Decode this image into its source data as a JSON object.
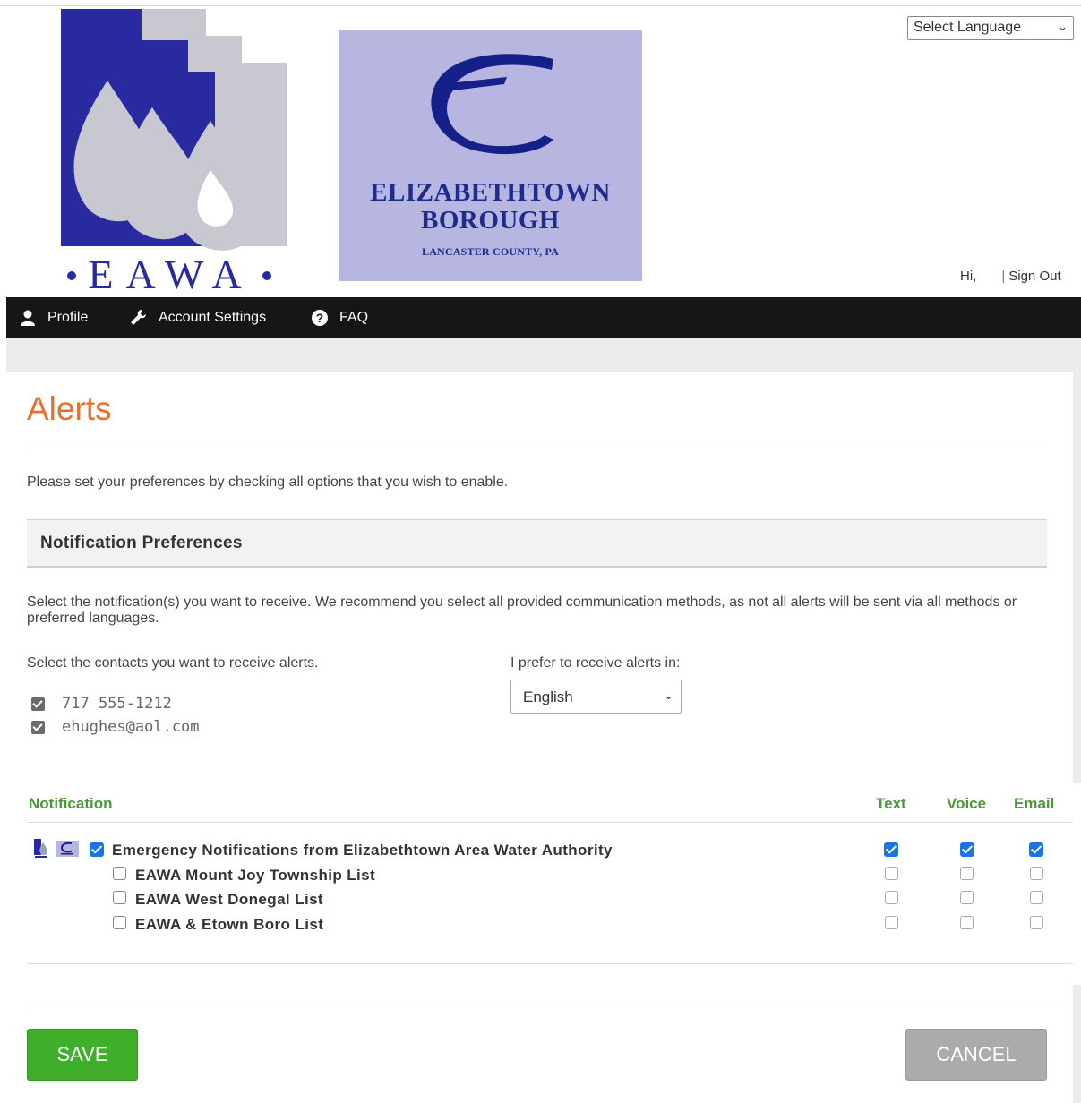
{
  "header": {
    "eawa_logo_text": "EAWA",
    "borough_name_line1": "ELIZABETHTOWN",
    "borough_name_line2": "BOROUGH",
    "borough_county": "LANCASTER COUNTY, PA",
    "language_select": "Select Language",
    "greeting": "Hi,",
    "sign_out": "Sign Out"
  },
  "nav": {
    "items": [
      {
        "label": "Profile",
        "icon": "user-icon"
      },
      {
        "label": "Account Settings",
        "icon": "wrench-icon"
      },
      {
        "label": "FAQ",
        "icon": "question-icon"
      }
    ]
  },
  "page": {
    "title": "Alerts",
    "intro": "Please set your preferences by checking all options that you wish to enable."
  },
  "preferences": {
    "section_title": "Notification Preferences",
    "description": "Select the notification(s) you want to receive. We recommend you select all provided communication methods, as not all alerts will be sent via all methods or preferred languages.",
    "contacts_label": "Select the contacts you want to receive alerts.",
    "contacts": [
      {
        "value": "717 555-1212",
        "checked": true
      },
      {
        "value": "ehughes@aol.com",
        "checked": true
      }
    ],
    "prefer_label": "I prefer to receive alerts in:",
    "language_value": "English"
  },
  "table": {
    "headers": {
      "notification": "Notification",
      "text": "Text",
      "voice": "Voice",
      "email": "Email"
    },
    "rows": [
      {
        "label": "Emergency Notifications from Elizabethtown Area Water Authority",
        "checked": true,
        "text": true,
        "voice": true,
        "email": true
      },
      {
        "label": "EAWA Mount Joy Township List",
        "checked": false,
        "text": false,
        "voice": false,
        "email": false
      },
      {
        "label": "EAWA West Donegal List",
        "checked": false,
        "text": false,
        "voice": false,
        "email": false
      },
      {
        "label": "EAWA & Etown Boro List",
        "checked": false,
        "text": false,
        "voice": false,
        "email": false
      }
    ]
  },
  "actions": {
    "save": "SAVE",
    "cancel": "CANCEL"
  },
  "colors": {
    "accent_orange": "#e8702a",
    "header_green": "#4a9a3a",
    "save_green": "#3fae2a",
    "navbar": "#161616",
    "checkbox_blue": "#1a73e8"
  }
}
